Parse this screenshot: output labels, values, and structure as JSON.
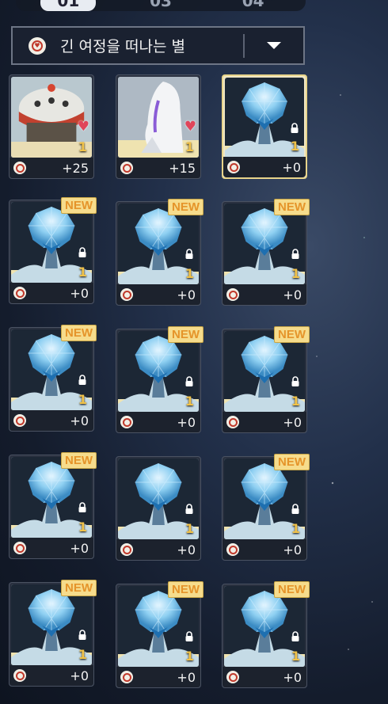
{
  "top_tabs": [
    {
      "label": "01",
      "active": true
    },
    {
      "label": "03",
      "active": false
    },
    {
      "label": "04",
      "active": false
    }
  ],
  "filter": {
    "selected": "긴 여정을 떠나는 별",
    "icon": "constellation-heart-icon"
  },
  "colors": {
    "highlight": "#e8d48a",
    "new_tag": "#f6dc8c",
    "level": "#f0c24a"
  },
  "cards": [
    {
      "art": "robot-dome",
      "level": "1",
      "bonus": "+25",
      "favorite": true,
      "locked": false,
      "is_new": false,
      "selected": false
    },
    {
      "art": "white-hair-character",
      "level": "1",
      "bonus": "+15",
      "favorite": true,
      "locked": false,
      "is_new": false,
      "selected": false
    },
    {
      "art": "crystal-tree",
      "level": "1",
      "bonus": "+0",
      "favorite": false,
      "locked": true,
      "is_new": false,
      "selected": true
    },
    {
      "art": "crystal-tree",
      "level": "1",
      "bonus": "+0",
      "favorite": false,
      "locked": true,
      "is_new": true,
      "new_label": "NEW",
      "selected": false
    },
    {
      "art": "crystal-tree",
      "level": "1",
      "bonus": "+0",
      "favorite": false,
      "locked": true,
      "is_new": true,
      "new_label": "NEW",
      "selected": false
    },
    {
      "art": "crystal-tree",
      "level": "1",
      "bonus": "+0",
      "favorite": false,
      "locked": true,
      "is_new": true,
      "new_label": "NEW",
      "selected": false
    },
    {
      "art": "crystal-tree",
      "level": "1",
      "bonus": "+0",
      "favorite": false,
      "locked": true,
      "is_new": true,
      "new_label": "NEW",
      "selected": false
    },
    {
      "art": "crystal-tree",
      "level": "1",
      "bonus": "+0",
      "favorite": false,
      "locked": true,
      "is_new": true,
      "new_label": "NEW",
      "selected": false
    },
    {
      "art": "crystal-tree",
      "level": "1",
      "bonus": "+0",
      "favorite": false,
      "locked": true,
      "is_new": true,
      "new_label": "NEW",
      "selected": false
    },
    {
      "art": "crystal-tree",
      "level": "1",
      "bonus": "+0",
      "favorite": false,
      "locked": true,
      "is_new": true,
      "new_label": "NEW",
      "selected": false
    },
    {
      "art": "crystal-tree",
      "level": "1",
      "bonus": "+0",
      "favorite": false,
      "locked": true,
      "is_new": false,
      "selected": false
    },
    {
      "art": "crystal-tree",
      "level": "1",
      "bonus": "+0",
      "favorite": false,
      "locked": true,
      "is_new": true,
      "new_label": "NEW",
      "selected": false
    },
    {
      "art": "crystal-tree",
      "level": "1",
      "bonus": "+0",
      "favorite": false,
      "locked": true,
      "is_new": true,
      "new_label": "NEW",
      "selected": false
    },
    {
      "art": "crystal-tree",
      "level": "1",
      "bonus": "+0",
      "favorite": false,
      "locked": true,
      "is_new": true,
      "new_label": "NEW",
      "selected": false
    },
    {
      "art": "crystal-tree",
      "level": "1",
      "bonus": "+0",
      "favorite": false,
      "locked": true,
      "is_new": true,
      "new_label": "NEW",
      "selected": false
    }
  ]
}
